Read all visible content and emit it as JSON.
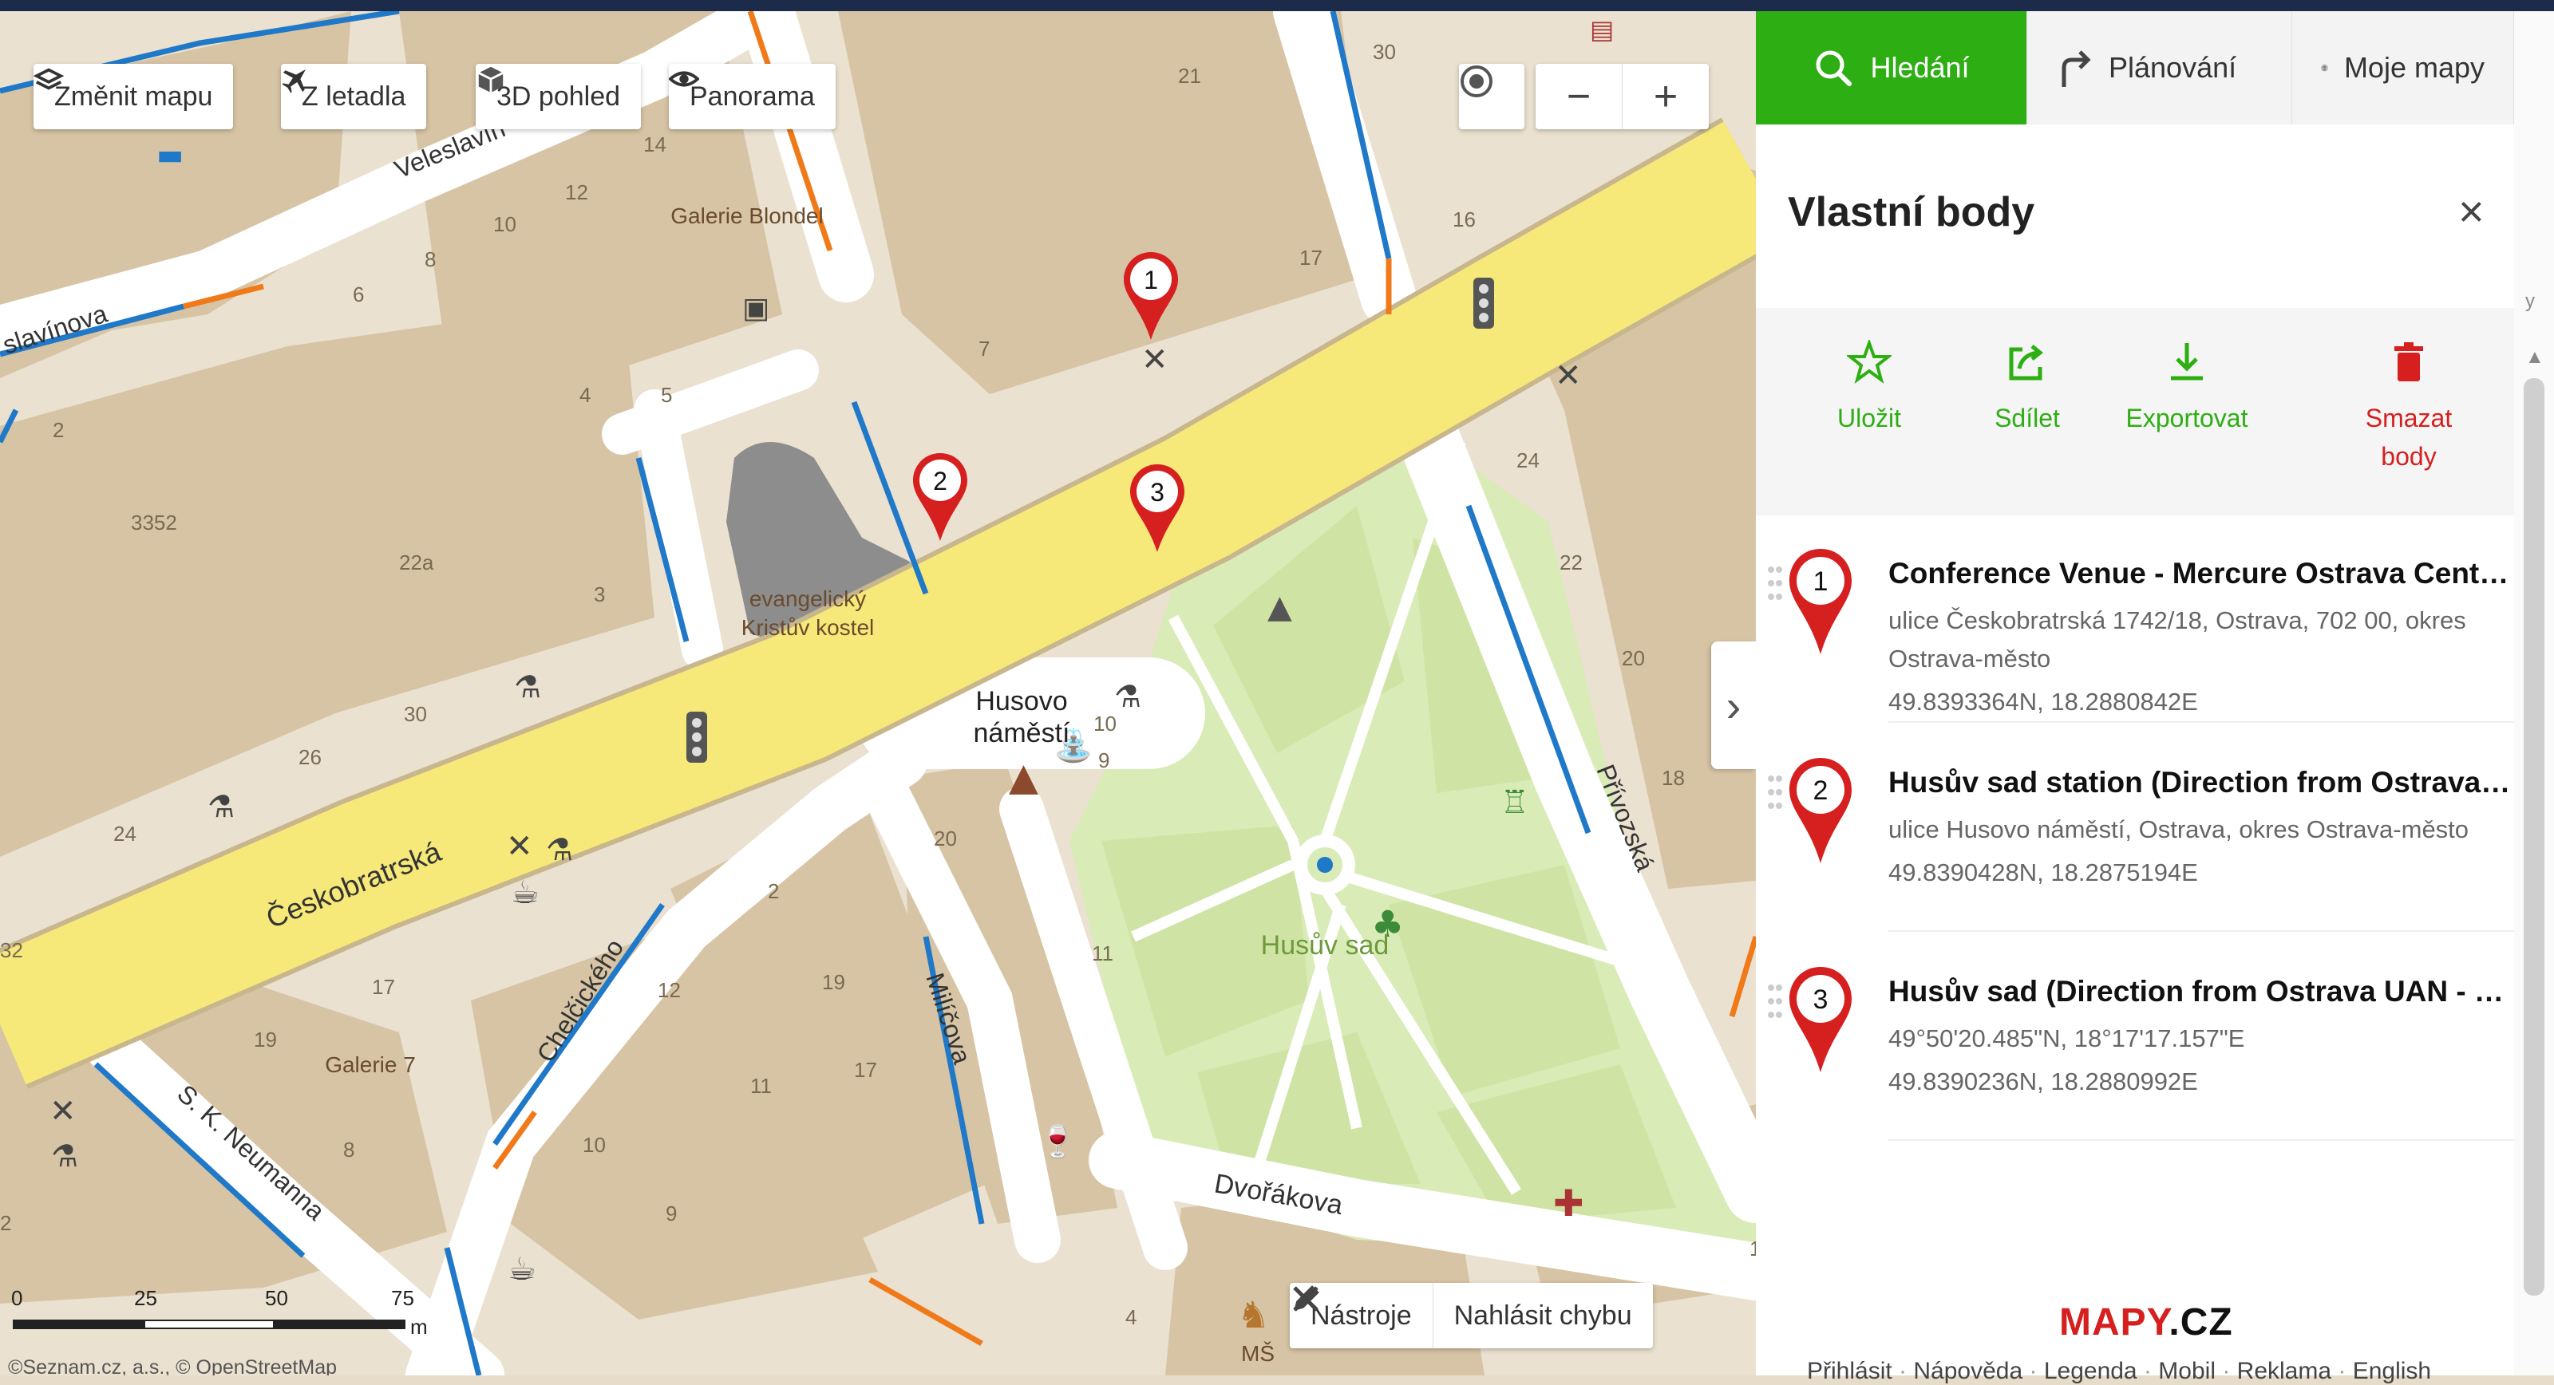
{
  "map": {
    "toolbar": {
      "change_map": "Změnit mapu",
      "aerial": "Z letadla",
      "view3d": "3D pohled",
      "panorama": "Panorama"
    },
    "zoom_out": "−",
    "zoom_in": "+",
    "tools": "Nástroje",
    "report_error": "Nahlásit chybu",
    "copyright": "©Seznam.cz, a.s., © OpenStreetMap",
    "scale": {
      "ticks": [
        "0",
        "25",
        "50",
        "75"
      ],
      "unit": "m"
    },
    "labels": {
      "street_ceskobratrska": "Českobratrská",
      "street_veleslavinova_top": "Veleslavín",
      "street_veleslavinova_left": "slavínova",
      "street_chelcickeho": "Chelčického",
      "street_milicova": "Milíčova",
      "street_privozska": "Přívozská",
      "street_dvorakova": "Dvořákova",
      "street_neumanna": "S. K. Neumanna",
      "square": "Husovo\nnáměstí",
      "park": "Husův sad",
      "church": "evangelický\nKristův kostel",
      "gallery_blondel": "Galerie Blondel",
      "gallery7": "Galerie 7",
      "ms": "MŠ"
    },
    "house_numbers": [
      "21",
      "30",
      "14",
      "12",
      "10",
      "8",
      "6",
      "4",
      "2",
      "3352",
      "22a",
      "3",
      "5",
      "7",
      "16",
      "17",
      "24",
      "22",
      "20",
      "18",
      "26",
      "30",
      "24",
      "20",
      "2",
      "19",
      "17",
      "12",
      "11",
      "10",
      "9",
      "8",
      "19",
      "17",
      "11",
      "10",
      "9",
      "12",
      "32",
      "4",
      "2"
    ],
    "markers": [
      "1",
      "2",
      "3"
    ]
  },
  "panel": {
    "tabs": [
      "Hledání",
      "Plánování",
      "Moje mapy"
    ],
    "title": "Vlastní body",
    "close": "×",
    "actions": {
      "save": "Uložit",
      "share": "Sdílet",
      "export": "Exportovat",
      "delete_line1": "Smazat",
      "delete_line2": "body"
    },
    "points": [
      {
        "num": "1",
        "title": "Conference Venue - Mercure Ostrava Center Hotel",
        "line1": "ulice Českobratrská 1742/18, Ostrava, 702 00, okres Ostrava-město",
        "line2": "49.8393364N, 18.2880842E"
      },
      {
        "num": "2",
        "title": "Husův sad station (Direction from Ostrava hl.n.)",
        "line1": "ulice Husovo náměstí, Ostrava, okres Ostrava-město",
        "line2": "49.8390428N, 18.2875194E"
      },
      {
        "num": "3",
        "title": "Husův sad (Direction from Ostrava UAN - Bus)",
        "line1": "49°50'20.485\"N, 18°17'17.157\"E",
        "line2": "49.8390236N, 18.2880992E"
      }
    ],
    "logo_red": "MAPY",
    "logo_dark": ".CZ",
    "footer_links": [
      "Přihlásit",
      "Nápověda",
      "Legenda",
      "Mobil",
      "Reklama",
      "English"
    ],
    "side_hint": "y"
  },
  "colors": {
    "green": "#2dae13",
    "red": "#d61f1f",
    "road_main": "#f6e97a",
    "building": "#d6c2a2",
    "park": "#d9ebb6",
    "bike_lane": "#1f78c8",
    "bike_lane_orange": "#f07a1a"
  }
}
